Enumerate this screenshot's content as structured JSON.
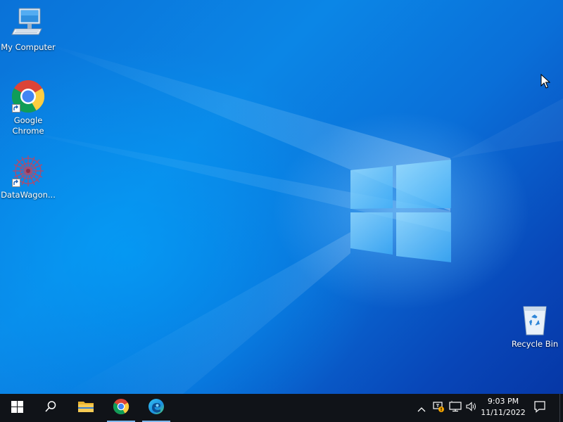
{
  "desktop": {
    "icons": [
      {
        "label": "My Computer",
        "icon": "computer-icon"
      },
      {
        "label": "Google Chrome",
        "icon": "chrome-icon"
      },
      {
        "label": "DataWagon...",
        "icon": "datawagon-icon"
      },
      {
        "label": "Recycle Bin",
        "icon": "recycle-bin-icon"
      }
    ],
    "wallpaper_colors": {
      "primary": "#0a78e0",
      "dark": "#0637a6",
      "glow": "#78c8ff"
    }
  },
  "taskbar": {
    "background": "#101318",
    "buttons": [
      {
        "name": "start",
        "icon": "windows-start-icon"
      },
      {
        "name": "search",
        "icon": "search-icon"
      },
      {
        "name": "file-explorer",
        "icon": "folder-icon"
      },
      {
        "name": "chrome",
        "icon": "chrome-icon"
      },
      {
        "name": "edge",
        "icon": "edge-icon"
      }
    ],
    "tray": {
      "icons": [
        "chevron-up-icon",
        "network-warning-icon",
        "network-icon",
        "volume-icon"
      ],
      "time": "9:03 PM",
      "date": "11/11/2022",
      "notification_icon": "notification-icon"
    }
  }
}
